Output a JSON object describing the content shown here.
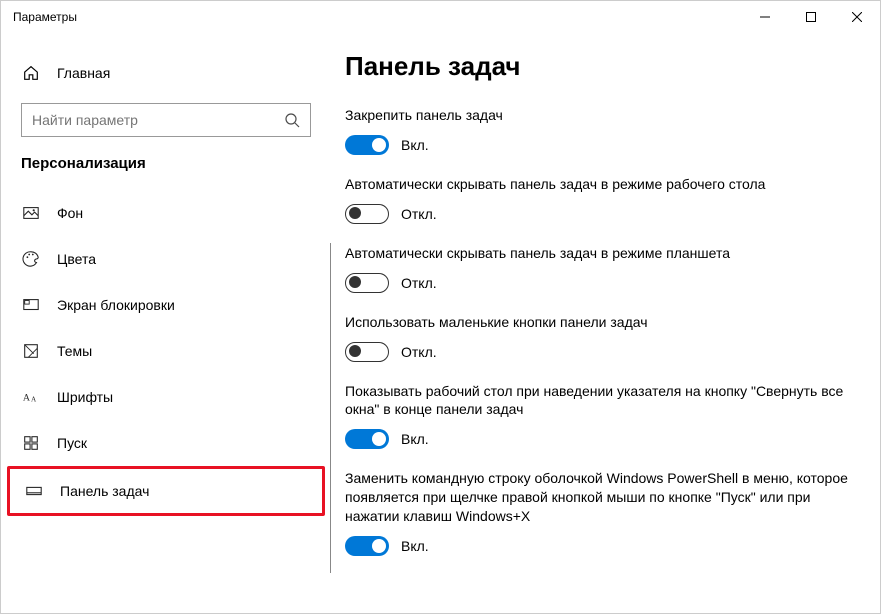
{
  "window": {
    "title": "Параметры"
  },
  "sidebar": {
    "home": "Главная",
    "search_placeholder": "Найти параметр",
    "section": "Персонализация",
    "items": [
      {
        "label": "Фон"
      },
      {
        "label": "Цвета"
      },
      {
        "label": "Экран блокировки"
      },
      {
        "label": "Темы"
      },
      {
        "label": "Шрифты"
      },
      {
        "label": "Пуск"
      },
      {
        "label": "Панель задач"
      }
    ]
  },
  "main": {
    "title": "Панель задач",
    "settings": [
      {
        "label": "Закрепить панель задач",
        "state": "Вкл.",
        "on": true
      },
      {
        "label": "Автоматически скрывать панель задач в режиме рабочего стола",
        "state": "Откл.",
        "on": false
      },
      {
        "label": "Автоматически скрывать панель задач в режиме планшета",
        "state": "Откл.",
        "on": false
      },
      {
        "label": "Использовать маленькие кнопки панели задач",
        "state": "Откл.",
        "on": false
      },
      {
        "label": "Показывать рабочий стол при наведении указателя на кнопку \"Свернуть все окна\" в конце панели задач",
        "state": "Вкл.",
        "on": true
      },
      {
        "label": "Заменить командную строку оболочкой Windows PowerShell в меню, которое появляется при щелчке правой кнопкой мыши по кнопке \"Пуск\" или при нажатии клавиш Windows+X",
        "state": "Вкл.",
        "on": true
      }
    ]
  }
}
